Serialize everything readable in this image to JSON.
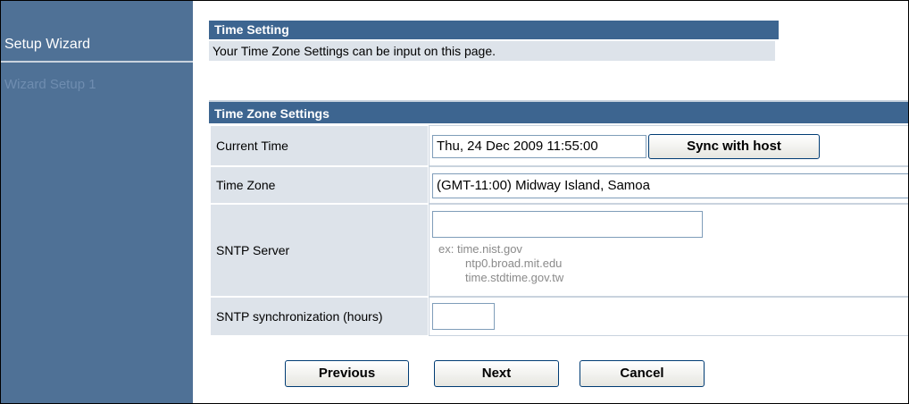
{
  "sidebar": {
    "items": [
      {
        "label": "Setup Wizard"
      },
      {
        "label": "Wizard Setup 1"
      }
    ]
  },
  "page": {
    "title": "Time Setting",
    "description": "Your Time Zone Settings can be input on this page."
  },
  "settings": {
    "section_title": "Time Zone Settings",
    "current_time": {
      "label": "Current Time",
      "value": "Thu, 24 Dec 2009 11:55:00",
      "sync_label": "Sync with host"
    },
    "time_zone": {
      "label": "Time Zone",
      "value": "(GMT-11:00) Midway Island, Samoa"
    },
    "sntp_server": {
      "label": "SNTP Server",
      "value": "",
      "examples": [
        "ex: time.nist.gov",
        "ntp0.broad.mit.edu",
        "time.stdtime.gov.tw"
      ]
    },
    "sntp_sync": {
      "label": "SNTP synchronization (hours)",
      "value": ""
    }
  },
  "buttons": {
    "previous": "Previous",
    "next": "Next",
    "cancel": "Cancel"
  }
}
